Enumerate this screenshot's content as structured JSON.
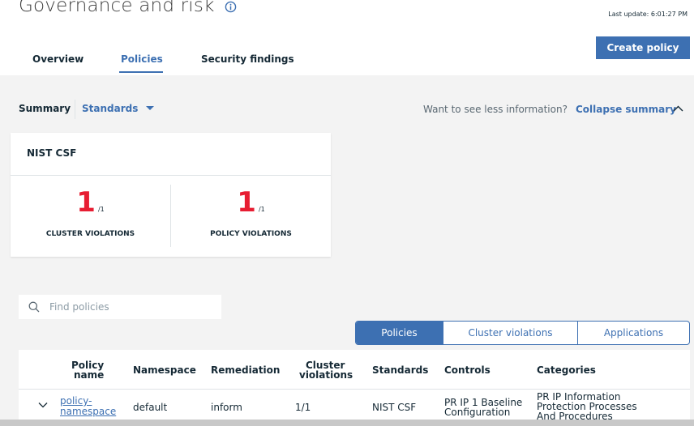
{
  "header": {
    "title": "Governance and risk",
    "last_update": "Last update:  6:01:27 PM",
    "create_button": "Create policy"
  },
  "tabs": [
    {
      "label": "Overview"
    },
    {
      "label": "Policies",
      "active": true
    },
    {
      "label": "Security findings"
    }
  ],
  "summary": {
    "label": "Summary",
    "dropdown_value": "Standards",
    "hint_text": "Want to see less information?",
    "collapse_label": "Collapse summary"
  },
  "card": {
    "title": "NIST CSF",
    "metrics": [
      {
        "value": "1",
        "total": "/1",
        "label": "CLUSTER VIOLATIONS"
      },
      {
        "value": "1",
        "total": "/1",
        "label": "POLICY VIOLATIONS"
      }
    ]
  },
  "search": {
    "placeholder": "Find policies",
    "value": ""
  },
  "view_toggle": [
    {
      "label": "Policies",
      "active": true
    },
    {
      "label": "Cluster violations"
    },
    {
      "label": "Applications"
    }
  ],
  "table": {
    "headers": {
      "policy_name_1": "Policy",
      "policy_name_2": "name",
      "namespace": "Namespace",
      "remediation": "Remediation",
      "cluster_violations_1": "Cluster",
      "cluster_violations_2": "violations",
      "standards": "Standards",
      "controls": "Controls",
      "categories": "Categories"
    },
    "rows": [
      {
        "policy_name_1": "policy-",
        "policy_name_2": "namespace",
        "namespace": "default",
        "remediation": "inform",
        "cluster_violations": "1/1",
        "standards": "NIST CSF",
        "controls_1": "PR IP 1 Baseline",
        "controls_2": "Configuration",
        "categories_1": "PR IP Information",
        "categories_2": "Protection Processes",
        "categories_3": "And Procedures"
      }
    ]
  },
  "colors": {
    "accent": "#3d70b2",
    "violation": "#e71d32",
    "background": "#f3f3f3"
  },
  "icons": [
    "info-icon",
    "chevron-down-icon",
    "chevron-up-icon",
    "search-icon"
  ]
}
